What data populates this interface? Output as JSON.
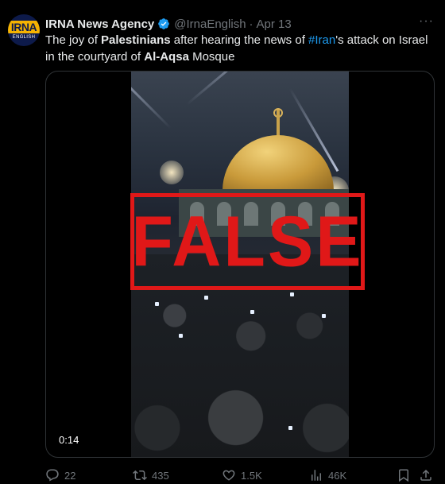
{
  "tweet": {
    "avatar_logo_top": "IRNA",
    "avatar_logo_bottom": "ENGLISH",
    "author_name": "IRNA News Agency",
    "handle": "@IrnaEnglish",
    "separator": "·",
    "date": "Apr 13",
    "more_label": "···",
    "text_parts": [
      {
        "text": "The joy of ",
        "style": "plain"
      },
      {
        "text": "Palestinians",
        "style": "bold"
      },
      {
        "text": " after hearing the news of ",
        "style": "plain"
      },
      {
        "text": "#Iran",
        "style": "hashtag"
      },
      {
        "text": "'s attack on Israel in the courtyard of ",
        "style": "plain"
      },
      {
        "text": "Al-Aqsa",
        "style": "bold"
      },
      {
        "text": " Mosque",
        "style": "plain"
      }
    ]
  },
  "media": {
    "stamp_text": "FALSE",
    "duration": "0:14",
    "stamp_color": "#e01818"
  },
  "actions": {
    "replies": "22",
    "reposts": "435",
    "likes": "1.5K",
    "views": "46K"
  },
  "colors": {
    "background": "#000000",
    "text": "#e7e9ea",
    "muted": "#71767b",
    "accent": "#1d9bf0"
  },
  "icons": [
    "verified-badge-icon",
    "more-icon",
    "reply-icon",
    "repost-icon",
    "like-icon",
    "views-icon",
    "bookmark-icon",
    "share-icon"
  ]
}
